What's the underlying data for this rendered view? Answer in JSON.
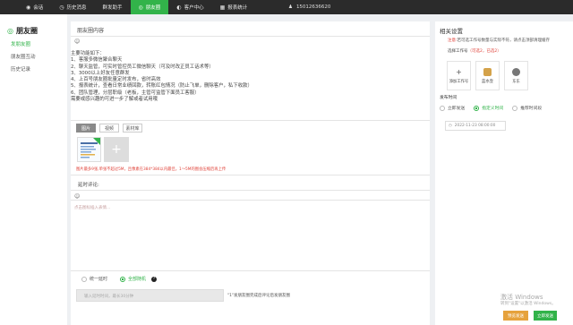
{
  "topnav": [
    {
      "icon": "chat-icon",
      "glyph": "◉",
      "label": "会话"
    },
    {
      "icon": "history-icon",
      "glyph": "◷",
      "label": "历史消息"
    },
    {
      "icon": "",
      "glyph": "",
      "label": "群发助手"
    },
    {
      "icon": "moments-icon",
      "glyph": "◎",
      "label": "朋友圈"
    },
    {
      "icon": "customer-icon",
      "glyph": "◐",
      "label": "客户中心"
    },
    {
      "icon": "report-icon",
      "glyph": "▦",
      "label": "报表统计"
    }
  ],
  "user": {
    "phone": "15012636620"
  },
  "sidebar": {
    "title": "朋友圈",
    "items": [
      {
        "label": "发朋友圈"
      },
      {
        "label": "朋友圈互动"
      },
      {
        "label": "历史记录"
      }
    ]
  },
  "main": {
    "title": "朋友圈内容",
    "lines": [
      "主要功能如下：",
      "1、客服多微信聚合聊天",
      "2、聊天监管，可实时管控员工微信聊天（可及时改正员工话术等）",
      "3、3000以上好友任意群发",
      "4、上百号朋友圈批量定时发布，省时高效",
      "5、报表统计，查看日常业绩回款，转账红包情况（防止飞单，删除客户，私下收款）",
      "6、团队管理，分层职级（老板，主管可监管下面员工客服）",
      "需要或感兴趣的可进一步了解或者试用哦"
    ],
    "tabs": [
      "图片",
      "视频",
      "素材库"
    ],
    "upload_warning": "图片最多9张,单张不超过5M，且像素在384*384以内最佳。1～5M的图会压缩后再上传",
    "comment_title": "延时评论:",
    "comment_placeholder": "点击图标插入表情...",
    "delay_options": [
      "统一延时",
      "全部随机"
    ],
    "delay_placeholder": "输入延时时间，最长30分钟",
    "delay_hint": "\"1\"发朋友圈完成后评论后发朋友圈"
  },
  "right": {
    "title": "相关设置",
    "notice_prefix": "注意:",
    "notice_text": "若可选工作号数量与实际不符，请点击顶部清理缓存",
    "account_label": "选择工作号",
    "account_count": "（可选2，已选2）",
    "cards": [
      {
        "label": "添加工作号",
        "type": "add"
      },
      {
        "label": "蓝水壶",
        "type": "avatar2"
      },
      {
        "label": "东东",
        "type": "avatar"
      }
    ],
    "publish_label": "发布时间",
    "send_options": [
      "立即发送",
      "指定义时间",
      "推荐时间段"
    ],
    "date_value": "2022-11-23 08:00:00"
  },
  "watermark": {
    "line1": "激活 Windows",
    "line2": "转到\"设置\"以激活 Windows。"
  },
  "buttons": {
    "schedule": "预览发送",
    "send_now": "立即发送"
  },
  "colors": {
    "accent": "#32b34a",
    "warning": "#e0433a",
    "nav_bg": "#2b2b2b",
    "orange": "#e6a23c"
  }
}
